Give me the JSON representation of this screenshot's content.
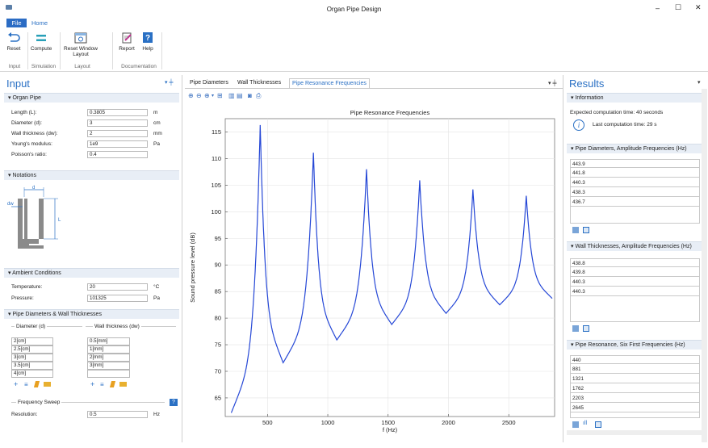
{
  "window": {
    "title": "Organ Pipe Design",
    "minimize": "–",
    "maximize": "☐",
    "close": "✕"
  },
  "ribbon": {
    "tabs": [
      "File",
      "Home"
    ],
    "buttons": {
      "reset": "Reset",
      "compute": "Compute",
      "reset_layout_1": "Reset Window",
      "reset_layout_2": "Layout",
      "report": "Report",
      "help": "Help"
    },
    "groups": {
      "input": "Input",
      "simulation": "Simulation",
      "layout": "Layout",
      "documentation": "Documentation"
    }
  },
  "input": {
    "title": "Input",
    "organ_pipe": {
      "header": "Organ Pipe",
      "rows": [
        {
          "label": "Length (L):",
          "value": "0.3805",
          "unit": "m"
        },
        {
          "label": "Diameter (d):",
          "value": "3",
          "unit": "cm"
        },
        {
          "label": "Wall thickness (dw):",
          "value": "2",
          "unit": "mm"
        },
        {
          "label": "Young's modulus:",
          "value": "1e9",
          "unit": "Pa"
        },
        {
          "label": "Poisson's ratio:",
          "value": "0.4",
          "unit": ""
        }
      ]
    },
    "notations": {
      "header": "Notations",
      "d": "d",
      "dw": "dw",
      "L": "L"
    },
    "ambient": {
      "header": "Ambient Conditions",
      "rows": [
        {
          "label": "Temperature:",
          "value": "20",
          "unit": "°C"
        },
        {
          "label": "Pressure:",
          "value": "101325",
          "unit": "Pa"
        }
      ]
    },
    "diameters": {
      "header": "Pipe Diameters & Wall Thicknesses",
      "col_diameter": "Diameter (d)",
      "col_wall": "Wall thickness (dw)",
      "diameter_values": [
        "2[cm]",
        "2.5[cm]",
        "3[cm]",
        "3.5[cm]",
        "4[cm]"
      ],
      "wall_values": [
        "0.5[mm]",
        "1[mm]",
        "2[mm]",
        "3[mm]",
        ""
      ]
    },
    "sweep": {
      "header": "Frequency Sweep",
      "label": "Resolution:",
      "value": "0.5",
      "unit": "Hz",
      "help": "?"
    }
  },
  "center": {
    "tabs": [
      "Pipe Diameters",
      "Wall Thicknesses",
      "Pipe Resonance Frequencies"
    ],
    "pin": "▾ ╪"
  },
  "results": {
    "title": "Results",
    "information": {
      "header": "Information",
      "expected": "Expected computation time: 40 seconds",
      "last": "Last computation time: 29 s"
    },
    "diam_table": {
      "header": "Pipe Diameters, Amplitude Frequencies (Hz)",
      "values": [
        "443.9",
        "441.8",
        "440.3",
        "438.3",
        "436.7"
      ]
    },
    "wall_table": {
      "header": "Wall Thicknesses, Amplitude Frequencies (Hz)",
      "values": [
        "438.8",
        "439.8",
        "440.3",
        "440.3"
      ]
    },
    "res_table": {
      "header": "Pipe Resonance, Six First Frequencies (Hz)",
      "values": [
        "440",
        "881",
        "1321",
        "1762",
        "2203",
        "2645"
      ]
    }
  },
  "colors": {
    "accent": "#2a70c4",
    "file_tab": "#2b6cc4",
    "line": "#2547d6"
  },
  "chart_data": {
    "type": "line",
    "title": "Pipe Resonance Frequencies",
    "xlabel": "f (Hz)",
    "ylabel": "Sound pressure level (dB)",
    "xlim": [
      150,
      2880
    ],
    "ylim": [
      61.5,
      117.5
    ],
    "xticks": [
      500,
      1000,
      1500,
      2000,
      2500
    ],
    "yticks": [
      65,
      70,
      75,
      80,
      85,
      90,
      95,
      100,
      105,
      110,
      115
    ],
    "grid": true,
    "peaks": [
      {
        "f": 440,
        "level": 116.3
      },
      {
        "f": 881,
        "level": 111.1
      },
      {
        "f": 1321,
        "level": 108.0
      },
      {
        "f": 1762,
        "level": 105.9
      },
      {
        "f": 2203,
        "level": 104.2
      },
      {
        "f": 2645,
        "level": 103.0
      }
    ],
    "minima": [
      {
        "f": 630,
        "level": 71.6
      },
      {
        "f": 1075,
        "level": 75.9
      },
      {
        "f": 1530,
        "level": 78.8
      },
      {
        "f": 1980,
        "level": 80.9
      },
      {
        "f": 2425,
        "level": 82.5
      }
    ],
    "start": {
      "f": 200,
      "level": 62.2
    },
    "end": {
      "f": 2860,
      "level": 83.7
    }
  }
}
